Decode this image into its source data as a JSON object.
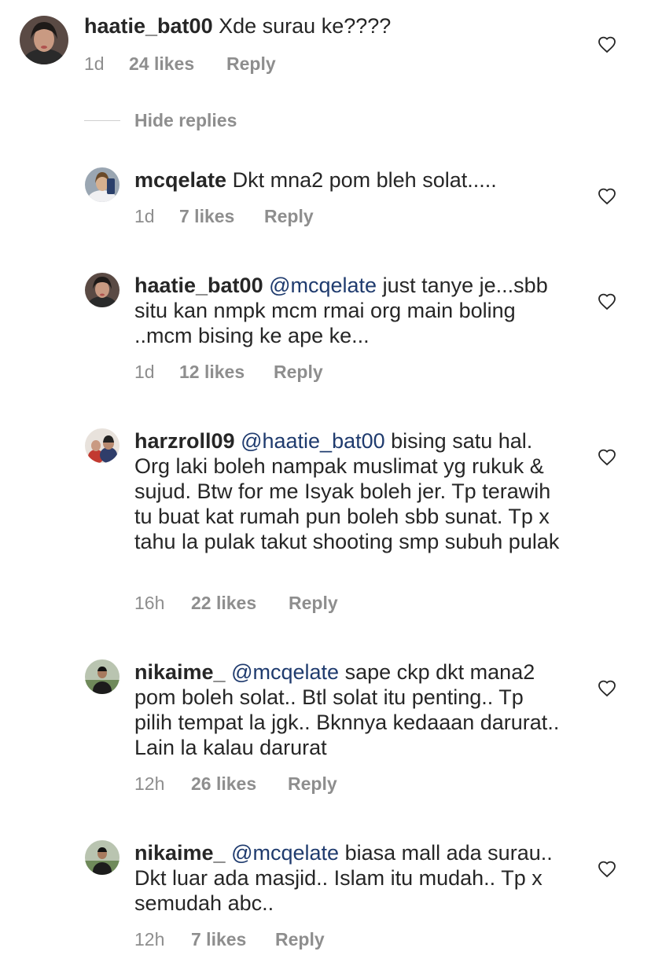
{
  "comments": [
    {
      "username": "haatie_bat00",
      "mention": "",
      "text": "Xde surau ke????",
      "time": "1d",
      "likes": "24 likes",
      "reply": "Reply"
    }
  ],
  "hide_replies": "Hide replies",
  "replies": [
    {
      "username": "mcqelate",
      "mention": "",
      "text": "Dkt mna2 pom bleh solat.....",
      "time": "1d",
      "likes": "7 likes",
      "reply": "Reply"
    },
    {
      "username": "haatie_bat00",
      "mention": "@mcqelate",
      "text": "just tanye je...sbb situ kan nmpk mcm rmai org main boling ..mcm bising ke ape ke...",
      "time": "1d",
      "likes": "12 likes",
      "reply": "Reply"
    },
    {
      "username": "harzroll09",
      "mention": "@haatie_bat00",
      "text": "bising satu hal. Org laki boleh nampak muslimat yg rukuk & sujud. Btw for me Isyak boleh jer. Tp terawih tu buat kat rumah pun boleh sbb sunat. Tp x tahu la pulak takut shooting smp subuh pulak",
      "time": "16h",
      "likes": "22 likes",
      "reply": "Reply"
    },
    {
      "username": "nikaime_",
      "mention": "@mcqelate",
      "text": "sape ckp dkt mana2 pom boleh solat.. Btl solat itu penting.. Tp pilih tempat la jgk.. Bknnya kedaaan darurat.. Lain la kalau darurat",
      "time": "12h",
      "likes": "26 likes",
      "reply": "Reply"
    },
    {
      "username": "nikaime_",
      "mention": "@mcqelate",
      "text": "biasa mall ada surau.. Dkt luar ada masjid.. Islam itu mudah.. Tp x semudah abc..",
      "time": "12h",
      "likes": "7 likes",
      "reply": "Reply"
    }
  ],
  "colors": {
    "text": "#262626",
    "meta": "#8e8e8e",
    "mention": "#1f3b6e"
  },
  "icons": {
    "like": "heart-outline-icon"
  }
}
